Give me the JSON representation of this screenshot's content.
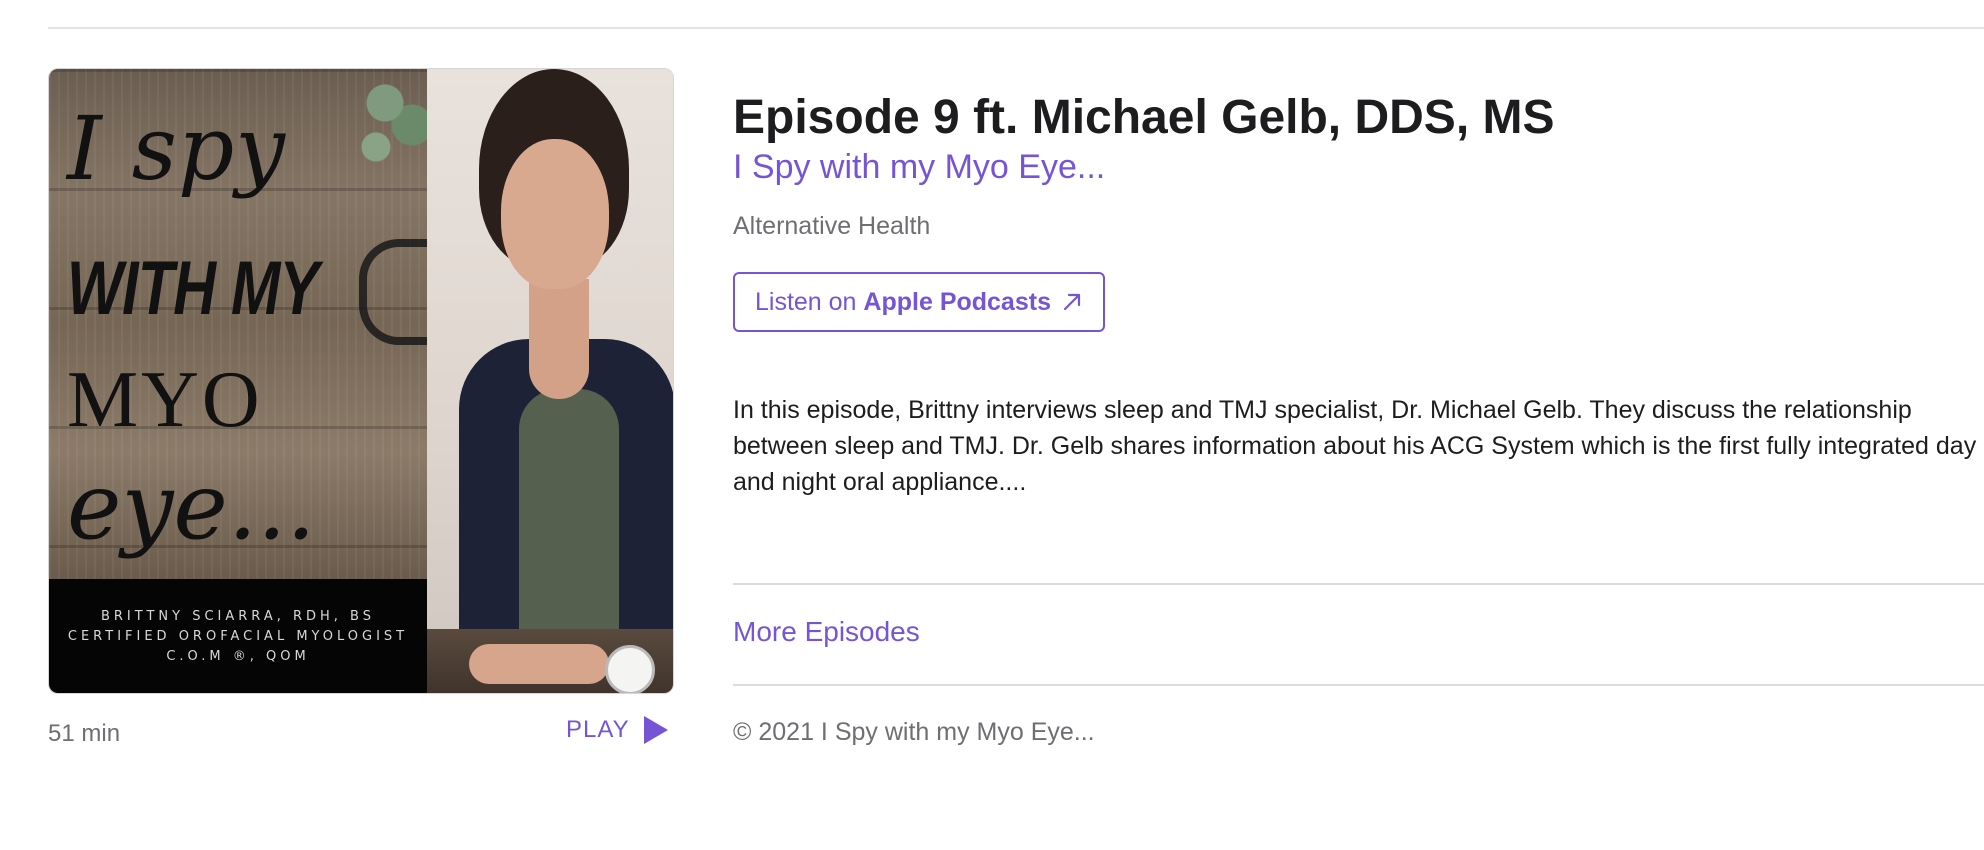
{
  "artwork": {
    "title_lines": [
      "I spy",
      "WITH MY",
      "MYO",
      "eye..."
    ],
    "banner_lines": [
      "BRITTNY SCIARRA, RDH, BS",
      "CERTIFIED OROFACIAL MYOLOGIST",
      "C.O.M ®, QOM"
    ]
  },
  "player": {
    "duration": "51 min",
    "play_label": "PLAY",
    "play_icon": "play-triangle-icon"
  },
  "episode": {
    "title": "Episode 9 ft. Michael Gelb, DDS, MS",
    "show_name": "I Spy with my Myo Eye...",
    "category": "Alternative Health",
    "listen": {
      "prefix": "Listen on ",
      "brand": "Apple Podcasts",
      "icon": "external-arrow-icon"
    },
    "description": "In this episode, Brittny interviews sleep and TMJ specialist, Dr. Michael Gelb. They discuss the relationship between sleep and TMJ. Dr. Gelb shares information about his ACG System which is the first fully integrated day and night oral appliance....",
    "more_episodes": "More Episodes",
    "copyright": "© 2021 I Spy with my Myo Eye..."
  },
  "colors": {
    "accent": "#7555d6",
    "text": "#1d1d1f",
    "secondary": "#6e6e73"
  }
}
